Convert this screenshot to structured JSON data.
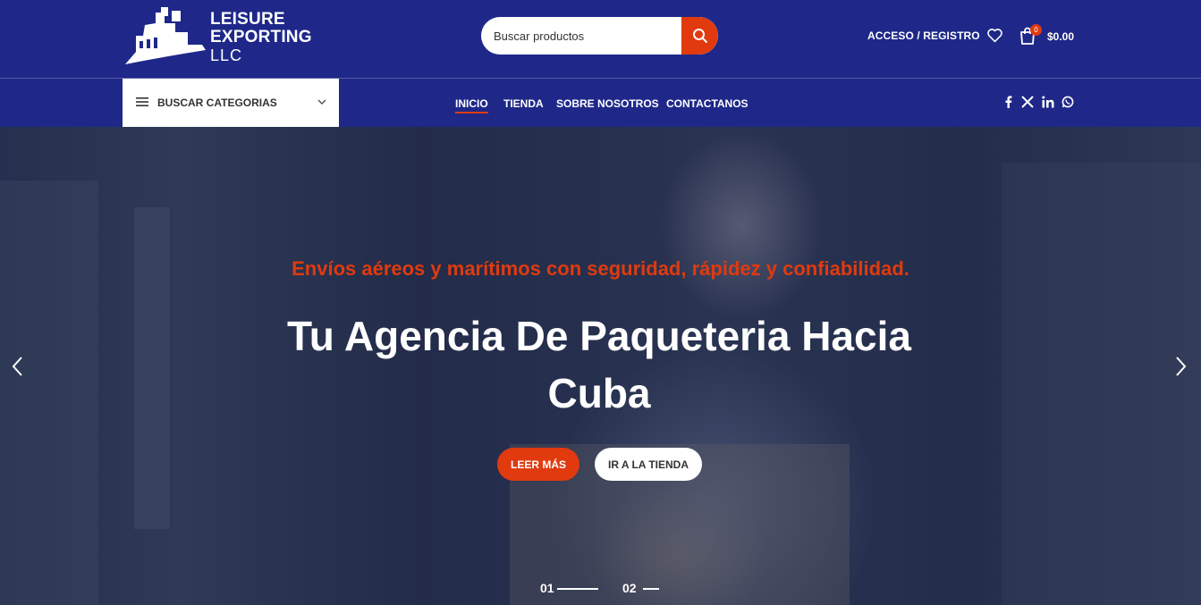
{
  "brand": {
    "line1": "LEISURE",
    "line2": "EXPORTING",
    "line3": "LLC"
  },
  "search": {
    "placeholder": "Buscar productos",
    "icon": "search-icon"
  },
  "account": {
    "label": "ACCESO / REGISTRO"
  },
  "cart": {
    "count": "0",
    "total": "$0.00"
  },
  "categories": {
    "label": "BUSCAR CATEGORIAS"
  },
  "nav": {
    "items": [
      "INICIO",
      "TIENDA",
      "SOBRE NOSOTROS",
      "CONTACTANOS"
    ],
    "active": "INICIO"
  },
  "social": [
    "facebook-icon",
    "x-icon",
    "linkedin-icon",
    "whatsapp-icon"
  ],
  "hero": {
    "subtitle": "Envíos aéreos y marítimos con seguridad, rápidez y confiabilidad.",
    "title_line1": "Tu Agencia De Paqueteria Hacia",
    "title_line2": "Cuba",
    "primary_button": "LEER MÁS",
    "secondary_button": "IR A LA TIENDA",
    "slides": [
      "01",
      "02"
    ]
  },
  "colors": {
    "header_bg": "#1f2889",
    "accent": "#e03a0e"
  }
}
